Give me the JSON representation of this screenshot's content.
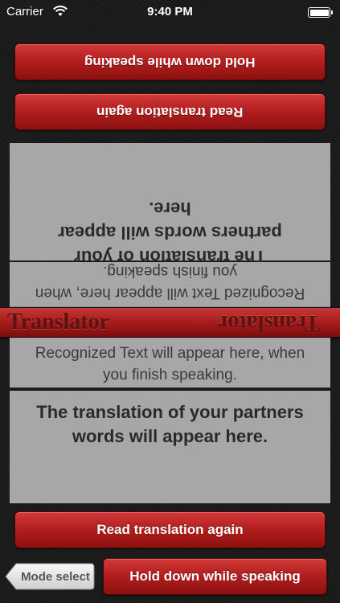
{
  "status_bar": {
    "carrier": "Carrier",
    "time": "9:40 PM",
    "wifi_icon": "wifi-icon",
    "battery_icon": "battery-icon",
    "battery_level": 1.0
  },
  "partner_side": {
    "speak_button": "Hold down while speaking",
    "read_again_button": "Read translation again",
    "translation_placeholder": "The translation of your partners words will appear here.",
    "recognized_placeholder": "Recognized Text will appear here, when you finish speaking."
  },
  "ribbon": {
    "title": "Translator"
  },
  "my_side": {
    "recognized_placeholder": "Recognized Text will appear here, when you finish speaking.",
    "translation_placeholder": "The translation of your partners words will appear here.",
    "read_again_button": "Read translation again",
    "speak_button": "Hold down while speaking"
  },
  "navigation": {
    "mode_select_label": "Mode select"
  },
  "colors": {
    "accent_red": "#b41f1f",
    "panel_grey": "#a7a7a7",
    "background": "#1d1d1d"
  }
}
